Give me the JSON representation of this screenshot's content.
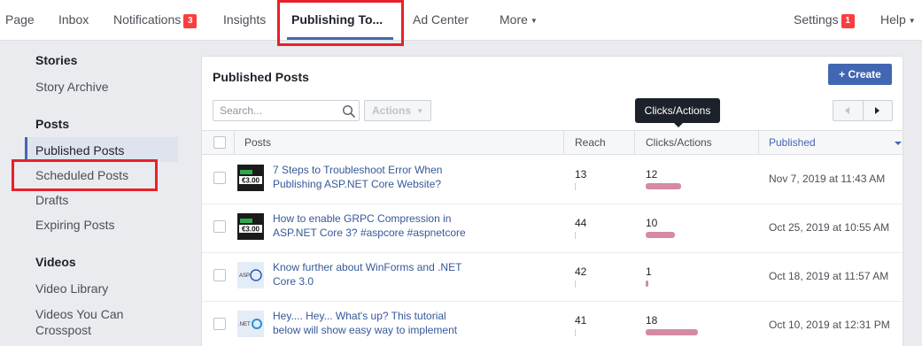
{
  "topnav": {
    "items": [
      {
        "label": "Page"
      },
      {
        "label": "Inbox"
      },
      {
        "label": "Notifications",
        "badge": "3"
      },
      {
        "label": "Insights"
      },
      {
        "label": "Publishing To..."
      },
      {
        "label": "Ad Center"
      },
      {
        "label": "More"
      },
      {
        "label": "Settings",
        "badge": "1"
      },
      {
        "label": "Help"
      }
    ],
    "active_index": 4
  },
  "sidebar": {
    "stories_heading": "Stories",
    "story_archive": "Story Archive",
    "posts_heading": "Posts",
    "published_posts": "Published Posts",
    "scheduled_posts": "Scheduled Posts",
    "drafts": "Drafts",
    "expiring_posts": "Expiring Posts",
    "videos_heading": "Videos",
    "video_library": "Video Library",
    "videos_crosspost_line1": "Videos You Can",
    "videos_crosspost_line2": "Crosspost"
  },
  "panel": {
    "title": "Published Posts",
    "create_label": "Create",
    "search_placeholder": "Search...",
    "actions_label": "Actions",
    "tooltip": "Clicks/Actions"
  },
  "table": {
    "headers": {
      "posts": "Posts",
      "reach": "Reach",
      "clicks": "Clicks/Actions",
      "published": "Published"
    },
    "sorted_column": "published",
    "rows": [
      {
        "title_l1": "7 Steps to Troubleshoot Error When",
        "title_l2": "Publishing ASP.NET Core Website?",
        "thumb_text": "€3.00",
        "reach": "13",
        "clicks": "12",
        "clicks_value": 12,
        "published": "Nov 7, 2019 at 11:43 AM"
      },
      {
        "title_l1": "How to enable GRPC Compression in",
        "title_l2": "ASP.NET Core 3? #aspcore #aspnetcore",
        "thumb_text": "€3.00",
        "reach": "44",
        "clicks": "10",
        "clicks_value": 10,
        "published": "Oct 25, 2019 at 10:55 AM"
      },
      {
        "title_l1": "Know further about WinForms and .NET",
        "title_l2": "Core 3.0",
        "thumb_text": "ASP",
        "reach": "42",
        "clicks": "1",
        "clicks_value": 1,
        "published": "Oct 18, 2019 at 11:57 AM"
      },
      {
        "title_l1": "Hey.... Hey... What's up? This tutorial",
        "title_l2": "below will show easy way to implement",
        "thumb_text": ".NET",
        "reach": "41",
        "clicks": "18",
        "clicks_value": 18,
        "published": "Oct 10, 2019 at 12:31 PM"
      }
    ]
  },
  "colors": {
    "accent": "#4267b2",
    "highlight": "#e8202a",
    "badge": "#fa3e3e",
    "link": "#365899"
  }
}
